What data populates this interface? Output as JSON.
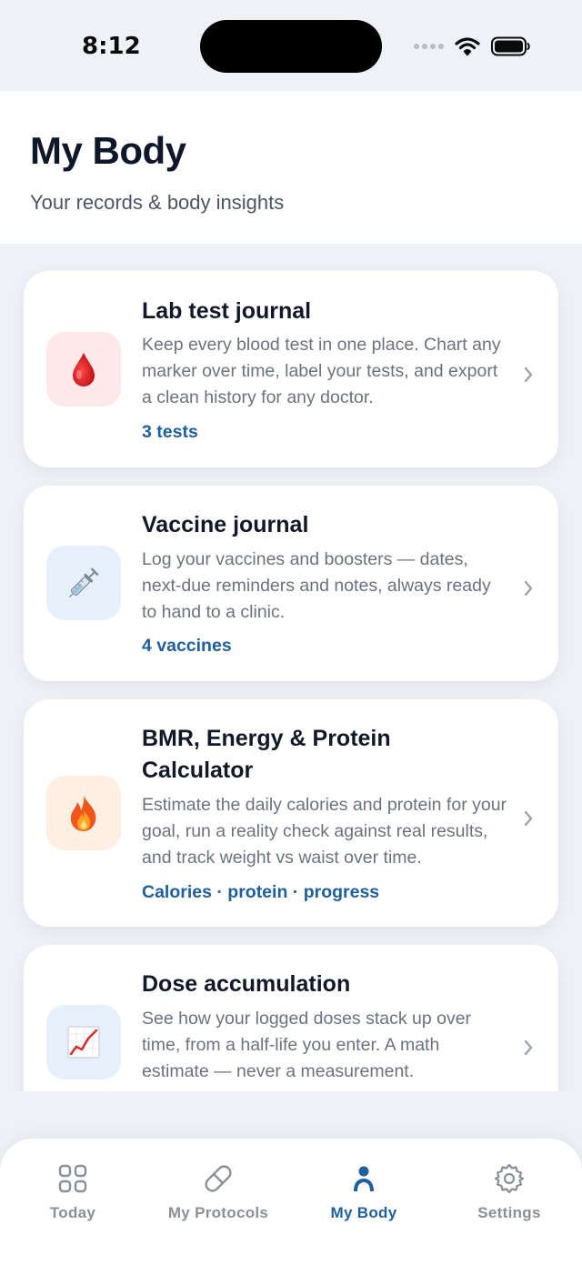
{
  "status_bar": {
    "time": "8:12"
  },
  "header": {
    "title": "My Body",
    "subtitle": "Your records & body insights"
  },
  "cards": [
    {
      "icon": "blood-drop-icon",
      "icon_bg": "#fde8ea",
      "title": "Lab test journal",
      "description": "Keep every blood test in one place. Chart any marker over time, label your tests, and export a clean history for any doctor.",
      "meta": "3 tests"
    },
    {
      "icon": "syringe-icon",
      "icon_bg": "#e6f0fb",
      "title": "Vaccine journal",
      "description": "Log your vaccines and boosters — dates, next-due reminders and notes, always ready to hand to a clinic.",
      "meta": "4 vaccines"
    },
    {
      "icon": "fire-icon",
      "icon_bg": "#fdf0e2",
      "title": "BMR, Energy & Protein Calculator",
      "description": "Estimate the daily calories and protein for your goal, run a reality check against real results, and track weight vs waist over time.",
      "meta": "Calories · protein · progress"
    },
    {
      "icon": "trend-chart-icon",
      "icon_bg": "#e6f0fb",
      "title": "Dose accumulation",
      "description": "See how your logged doses stack up over time, from a half-life you enter. A math estimate — never a measurement."
    }
  ],
  "tabs": [
    {
      "label": "Today",
      "icon": "grid-icon",
      "active": false
    },
    {
      "label": "My Protocols",
      "icon": "pill-icon",
      "active": false
    },
    {
      "label": "My Body",
      "icon": "person-icon",
      "active": true
    },
    {
      "label": "Settings",
      "icon": "gear-icon",
      "active": false
    }
  ],
  "colors": {
    "accent": "#1f5f9e",
    "background": "#eef2f7",
    "inactive_tab": "#8a8f98"
  }
}
